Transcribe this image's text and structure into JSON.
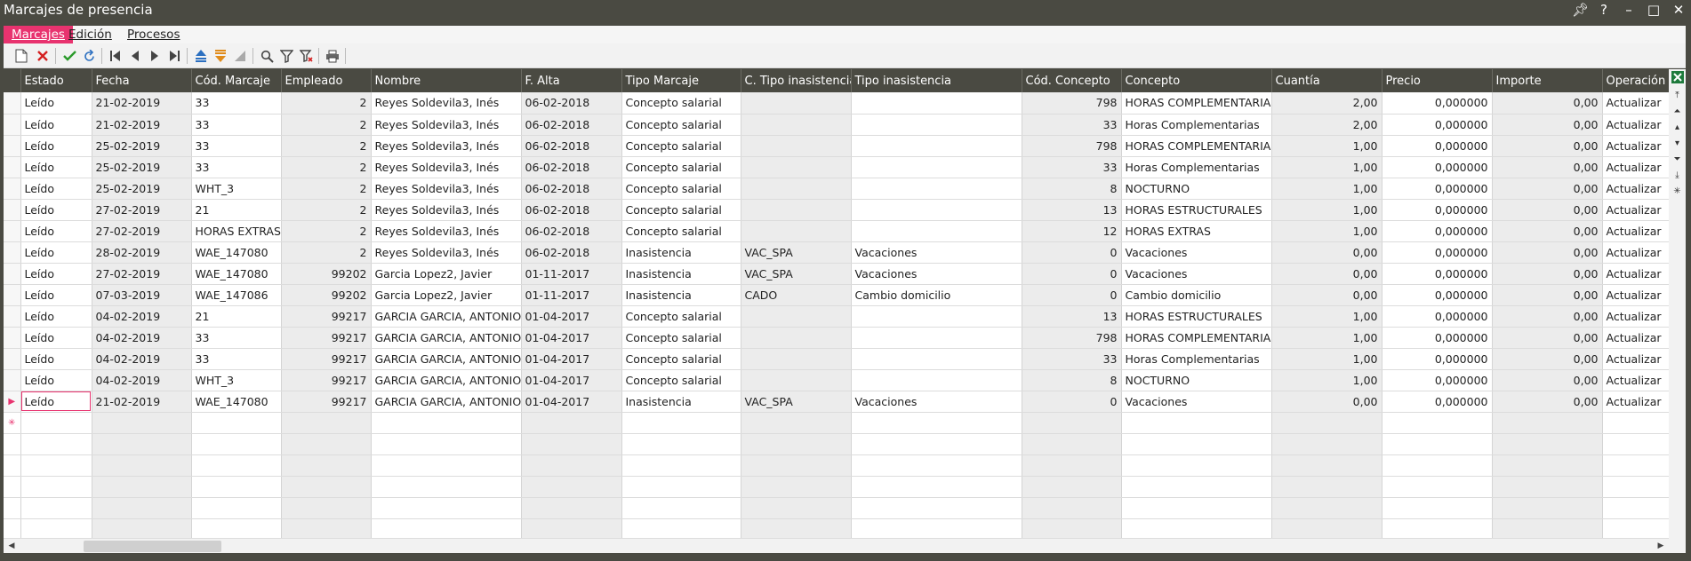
{
  "window": {
    "title": "Marcajes de presencia"
  },
  "title_controls": [
    "pin-icon",
    "help-icon",
    "minimize-icon",
    "maximize-icon",
    "close-icon"
  ],
  "menu": [
    {
      "label": "Marcajes",
      "active": true
    },
    {
      "label": "Edición",
      "active": false
    },
    {
      "label": "Procesos",
      "active": false
    }
  ],
  "toolbar_icons": [
    "new-icon",
    "delete-icon",
    "accept-icon",
    "refresh-icon",
    "first-record-icon",
    "previous-record-icon",
    "next-record-icon",
    "last-record-icon",
    "sort-ascending-icon",
    "sort-descending-icon",
    "clear-sort-icon",
    "search-icon",
    "filter-icon",
    "clear-filter-icon",
    "print-icon"
  ],
  "colors": {
    "accent": "#e8336f",
    "header_bg": "#4a4a42"
  },
  "grid": {
    "columns": [
      "Estado",
      "Fecha",
      "Cód. Marcaje",
      "Empleado",
      "Nombre",
      "F. Alta",
      "Tipo Marcaje",
      "C. Tipo inasistencia",
      "Tipo inasistencia",
      "Cód. Concepto",
      "Concepto",
      "Cuantía",
      "Precio",
      "Importe",
      "Operación"
    ],
    "rows": [
      [
        "Leído",
        "21-02-2019",
        "33",
        "2",
        "Reyes Soldevila3, Inés",
        "06-02-2018",
        "Concepto salarial",
        "",
        "",
        "798",
        "HORAS COMPLEMENTARIAS",
        "2,00",
        "0,000000",
        "0,00",
        "Actualizar"
      ],
      [
        "Leído",
        "21-02-2019",
        "33",
        "2",
        "Reyes Soldevila3, Inés",
        "06-02-2018",
        "Concepto salarial",
        "",
        "",
        "33",
        "Horas Complementarias",
        "2,00",
        "0,000000",
        "0,00",
        "Actualizar"
      ],
      [
        "Leído",
        "25-02-2019",
        "33",
        "2",
        "Reyes Soldevila3, Inés",
        "06-02-2018",
        "Concepto salarial",
        "",
        "",
        "798",
        "HORAS COMPLEMENTARIAS",
        "1,00",
        "0,000000",
        "0,00",
        "Actualizar"
      ],
      [
        "Leído",
        "25-02-2019",
        "33",
        "2",
        "Reyes Soldevila3, Inés",
        "06-02-2018",
        "Concepto salarial",
        "",
        "",
        "33",
        "Horas Complementarias",
        "1,00",
        "0,000000",
        "0,00",
        "Actualizar"
      ],
      [
        "Leído",
        "25-02-2019",
        "WHT_3",
        "2",
        "Reyes Soldevila3, Inés",
        "06-02-2018",
        "Concepto salarial",
        "",
        "",
        "8",
        "NOCTURNO",
        "1,00",
        "0,000000",
        "0,00",
        "Actualizar"
      ],
      [
        "Leído",
        "27-02-2019",
        "21",
        "2",
        "Reyes Soldevila3, Inés",
        "06-02-2018",
        "Concepto salarial",
        "",
        "",
        "13",
        "HORAS ESTRUCTURALES",
        "1,00",
        "0,000000",
        "0,00",
        "Actualizar"
      ],
      [
        "Leído",
        "27-02-2019",
        "HORAS EXTRAS",
        "2",
        "Reyes Soldevila3, Inés",
        "06-02-2018",
        "Concepto salarial",
        "",
        "",
        "12",
        "HORAS EXTRAS",
        "1,00",
        "0,000000",
        "0,00",
        "Actualizar"
      ],
      [
        "Leído",
        "28-02-2019",
        "WAE_147080",
        "2",
        "Reyes Soldevila3, Inés",
        "06-02-2018",
        "Inasistencia",
        "VAC_SPA",
        "Vacaciones",
        "0",
        "Vacaciones",
        "0,00",
        "0,000000",
        "0,00",
        "Actualizar"
      ],
      [
        "Leído",
        "27-02-2019",
        "WAE_147080",
        "99202",
        "Garcia Lopez2, Javier",
        "01-11-2017",
        "Inasistencia",
        "VAC_SPA",
        "Vacaciones",
        "0",
        "Vacaciones",
        "0,00",
        "0,000000",
        "0,00",
        "Actualizar"
      ],
      [
        "Leído",
        "07-03-2019",
        "WAE_147086",
        "99202",
        "Garcia Lopez2, Javier",
        "01-11-2017",
        "Inasistencia",
        "CADO",
        "Cambio domicilio",
        "0",
        "Cambio domicilio",
        "0,00",
        "0,000000",
        "0,00",
        "Actualizar"
      ],
      [
        "Leído",
        "04-02-2019",
        "21",
        "99217",
        "GARCIA GARCIA, ANTONIO",
        "01-04-2017",
        "Concepto salarial",
        "",
        "",
        "13",
        "HORAS ESTRUCTURALES",
        "1,00",
        "0,000000",
        "0,00",
        "Actualizar"
      ],
      [
        "Leído",
        "04-02-2019",
        "33",
        "99217",
        "GARCIA GARCIA, ANTONIO",
        "01-04-2017",
        "Concepto salarial",
        "",
        "",
        "798",
        "HORAS COMPLEMENTARIAS",
        "1,00",
        "0,000000",
        "0,00",
        "Actualizar"
      ],
      [
        "Leído",
        "04-02-2019",
        "33",
        "99217",
        "GARCIA GARCIA, ANTONIO",
        "01-04-2017",
        "Concepto salarial",
        "",
        "",
        "33",
        "Horas Complementarias",
        "1,00",
        "0,000000",
        "0,00",
        "Actualizar"
      ],
      [
        "Leído",
        "04-02-2019",
        "WHT_3",
        "99217",
        "GARCIA GARCIA, ANTONIO",
        "01-04-2017",
        "Concepto salarial",
        "",
        "",
        "8",
        "NOCTURNO",
        "1,00",
        "0,000000",
        "0,00",
        "Actualizar"
      ],
      [
        "Leído",
        "21-02-2019",
        "WAE_147080",
        "99217",
        "GARCIA GARCIA, ANTONIO",
        "01-04-2017",
        "Inasistencia",
        "VAC_SPA",
        "Vacaciones",
        "0",
        "Vacaciones",
        "0,00",
        "0,000000",
        "0,00",
        "Actualizar"
      ]
    ],
    "current_row_index": 14
  }
}
